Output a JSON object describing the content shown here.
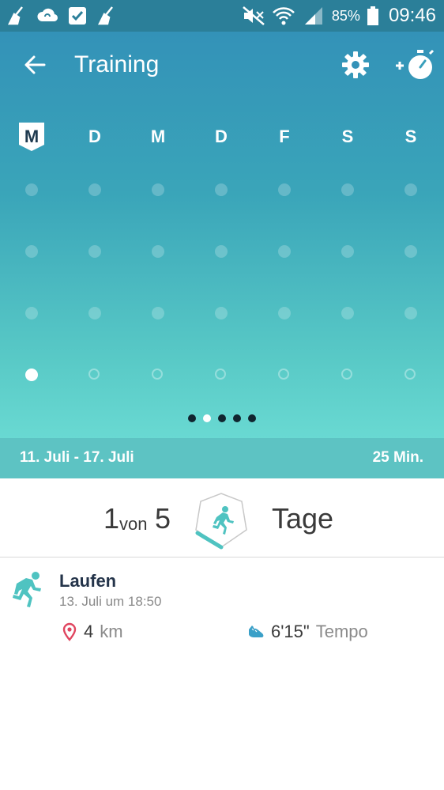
{
  "statusbar": {
    "battery_pct": "85%",
    "time": "09:46",
    "left_icons": [
      "broom-icon",
      "cloud-sync-icon",
      "check-box-icon",
      "broom-icon"
    ],
    "right_icons": [
      "mute-icon",
      "wifi-icon",
      "signal-icon",
      "battery-icon"
    ]
  },
  "appbar": {
    "title": "Training",
    "icons": [
      "back-arrow-icon",
      "gear-icon",
      "add-timer-icon"
    ]
  },
  "week": {
    "days": [
      "M",
      "D",
      "M",
      "D",
      "F",
      "S",
      "S"
    ],
    "active_day_index": 0,
    "rows": 4,
    "completed_days": [
      0
    ]
  },
  "pager": {
    "pages": 5,
    "current": 1
  },
  "range": {
    "dates": "11. Juli - 17. Juli",
    "total": "25 Min."
  },
  "summary": {
    "count": "1",
    "von": "von",
    "goal": "5",
    "label": "Tage",
    "progress_fraction": 0.2
  },
  "activity": {
    "title": "Laufen",
    "time": "13. Juli um 18:50",
    "distance_value": "4",
    "distance_unit": "km",
    "pace_value": "6'15\"",
    "pace_unit": "Tempo"
  },
  "colors": {
    "gradient_top": "#3392b8",
    "gradient_bottom": "#69d9d2",
    "teal": "#4fc3c1",
    "range_bar": "#5dc3c3",
    "pin": "#e0455f"
  }
}
